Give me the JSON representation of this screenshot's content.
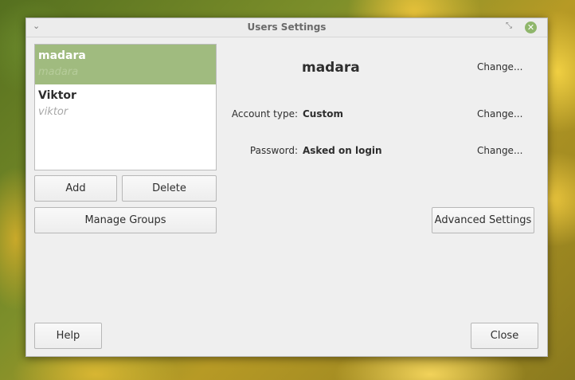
{
  "window": {
    "title": "Users Settings",
    "menu_glyph": "⌄",
    "restore_glyph": "⤡",
    "close_glyph": "✕"
  },
  "users": [
    {
      "name": "madara",
      "login": "madara",
      "selected": true
    },
    {
      "name": "Viktor",
      "login": "viktor",
      "selected": false
    }
  ],
  "list_buttons": {
    "add": "Add",
    "delete": "Delete",
    "manage_groups": "Manage Groups"
  },
  "details": {
    "heading": "madara",
    "change_label": "Change...",
    "account_type_label": "Account type:",
    "account_type_value": "Custom",
    "password_label": "Password:",
    "password_value": "Asked on login",
    "advanced_settings": "Advanced Settings"
  },
  "footer": {
    "help": "Help",
    "close": "Close"
  },
  "colors": {
    "selection": "#a0bb7f",
    "close_button": "#8fb66b",
    "window_bg": "#efefef"
  }
}
